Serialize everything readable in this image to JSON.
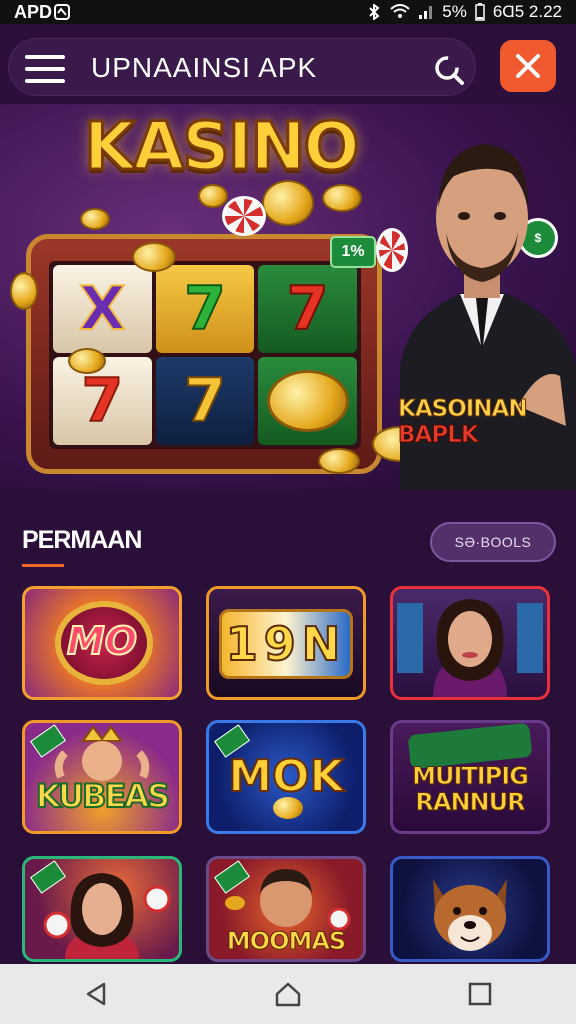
{
  "status_bar": {
    "left_text": "APD",
    "battery": "5%",
    "time": "6Ɑ5 2.22"
  },
  "app_bar": {
    "title": "UPNAAINSI APK",
    "menu_icon": "hamburger-menu-icon",
    "search_icon": "search-icon",
    "close_icon": "close-icon"
  },
  "banner": {
    "title": "KASINO",
    "badge": "1%",
    "host_label_line1": "KASOINAN",
    "host_label_line2": "BAPLK",
    "reels": [
      "X",
      "7",
      "7",
      "7",
      "7",
      ""
    ]
  },
  "section": {
    "title": "PERMAAN",
    "more_button": "SƏ·BOOLS"
  },
  "games": [
    {
      "label": "MO"
    },
    {
      "label": "19N"
    },
    {
      "label": ""
    },
    {
      "label": "KUBEAS"
    },
    {
      "label": "MOK"
    },
    {
      "label": "MUITIPIG RANNUR"
    },
    {
      "label": ""
    },
    {
      "label": "MOOMAS"
    },
    {
      "label": ""
    }
  ],
  "nav": {
    "back_icon": "back-triangle-icon",
    "home_icon": "home-icon",
    "recents_icon": "recents-square-icon"
  },
  "colors": {
    "background": "#2a0f38",
    "accent": "#f05a2e",
    "underline": "#f26a2b",
    "gold": "#ffcf3a"
  }
}
